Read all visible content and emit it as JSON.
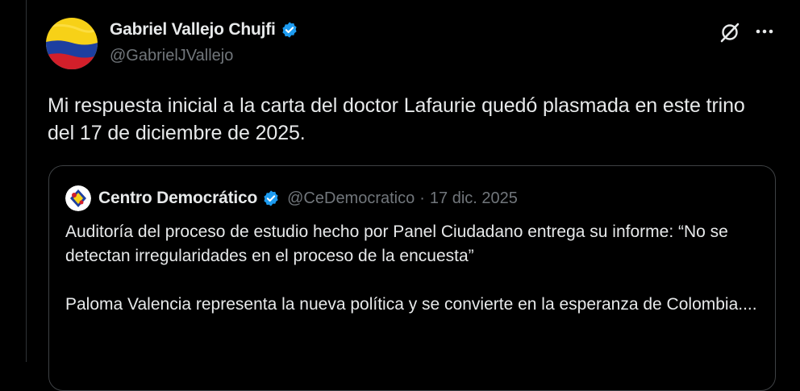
{
  "author": {
    "name": "Gabriel Vallejo Chujfi",
    "handle": "@GabrielJVallejo",
    "avatar_icon": "colombia-flag-avatar",
    "verified_icon": "verified-badge-icon"
  },
  "actions": {
    "grok_icon": "grok-icon",
    "more_icon": "more-options-icon"
  },
  "tweet": {
    "text": "Mi respuesta inicial a la carta del doctor Lafaurie quedó plasmada en este trino del 17 de diciembre de 2025."
  },
  "quoted": {
    "name": "Centro Democrático",
    "handle": "@CeDemocratico",
    "separator": "·",
    "date": "17 dic. 2025",
    "avatar_icon": "centro-democratico-logo",
    "paragraph1": "Auditoría del proceso de estudio hecho por Panel Ciudadano entrega su informe: “No se detectan irregularidades en el proceso de la encuesta”",
    "paragraph2": "Paloma Valencia representa la nueva política y se convierte en la esperanza de Colombia...."
  },
  "colors": {
    "background": "#000000",
    "text_primary": "#e7e9ea",
    "text_secondary": "#71767b",
    "verified_blue": "#1d9bf0",
    "border": "#2f3336"
  }
}
